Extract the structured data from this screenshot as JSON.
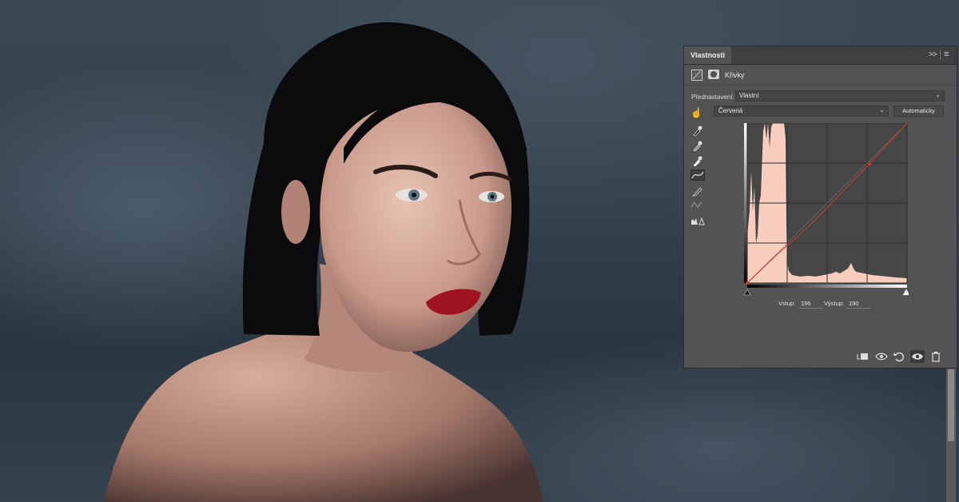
{
  "panel": {
    "tab_label": "Vlastnosti",
    "collapse_glyph": ">>",
    "menu_glyph": "≡",
    "adjustment_title": "Křivky",
    "preset_label": "Přednastavení:",
    "preset_value": "Vlastní",
    "channel_value": "Červená",
    "auto_label": "Automaticky",
    "input_label": "Vstup:",
    "input_value": "196",
    "output_label": "Výstup:",
    "output_value": "190"
  },
  "tools": [
    {
      "name": "sample-black-point",
      "icon": "eyedropper-icon"
    },
    {
      "name": "sample-gray-point",
      "icon": "eyedropper-icon"
    },
    {
      "name": "sample-white-point",
      "icon": "eyedropper-icon"
    },
    {
      "name": "edit-points",
      "icon": "curve-icon"
    },
    {
      "name": "draw-curve",
      "icon": "pencil-icon"
    },
    {
      "name": "smooth-curve",
      "icon": "smooth-icon"
    },
    {
      "name": "clipping-warning",
      "icon": "histogram-warning-icon"
    }
  ],
  "footer_icons": [
    "clip-to-layer-icon",
    "view-previous-icon",
    "reset-icon",
    "visibility-eye-icon",
    "trash-icon"
  ],
  "colors": {
    "panel_bg": "#535353",
    "histogram_fill": "#f7cdbd",
    "curve_line": "#c1392b"
  }
}
